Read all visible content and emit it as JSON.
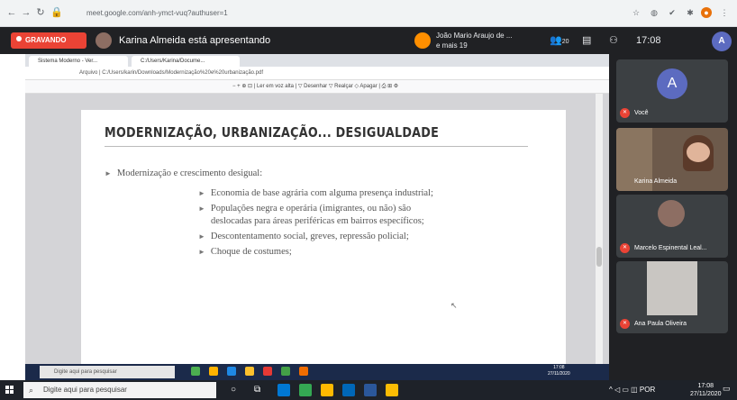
{
  "browser": {
    "url": "meet.google.com/anh-ymct-vuq?authuser=1"
  },
  "meet": {
    "recording_label": "GRAVANDO",
    "presenting_text": "Karina Almeida está apresentando",
    "other_participant": "João Mario Araujo de ...",
    "other_participant_sub": "e mais 19",
    "participant_count": "20",
    "clock": "17:08",
    "self_initial": "A"
  },
  "shared_screen": {
    "tab_1": "Sistema Moderno - Ver...",
    "tab_2": "C:/Users/Karina/Docume...",
    "inner_url": "Arquivo  |  C:/Users/karin/Downloads/Modernização%20e%20urbanização.pdf",
    "pdf_toolbar": "−   +   ⊕   ⊡   |   Ler em voz alta   |   ▽ Desenhar   ▽ Realçar   ◇ Apagar   |   ⎙   ⊞   ⚙",
    "slide": {
      "title": "MODERNIZAÇÃO, URBANIZAÇÃO... DESIGUALDADE",
      "bullet_main": "Modernização e crescimento desigual:",
      "sub_bullets": [
        "Economia de base agrária com alguma presença industrial;",
        "Populações negra e operária (imigrantes, ou não) são",
        "deslocadas para áreas periféricas em bairros específicos;",
        "Descontentamento social, greves, repressão policial;",
        "Choque de costumes;"
      ]
    },
    "taskbar_search": "Digite aqui para pesquisar",
    "taskbar_time": "17:08",
    "taskbar_date": "27/11/2020"
  },
  "participants": [
    {
      "name": "Você",
      "initial": "A"
    },
    {
      "name": "Karina Almeida"
    },
    {
      "name": "Marcelo Espinental Leal..."
    },
    {
      "name": "Ana Paula Oliveira"
    }
  ],
  "taskbar": {
    "search_placeholder": "Digite aqui para pesquisar",
    "time": "17:08",
    "date": "27/11/2020"
  }
}
